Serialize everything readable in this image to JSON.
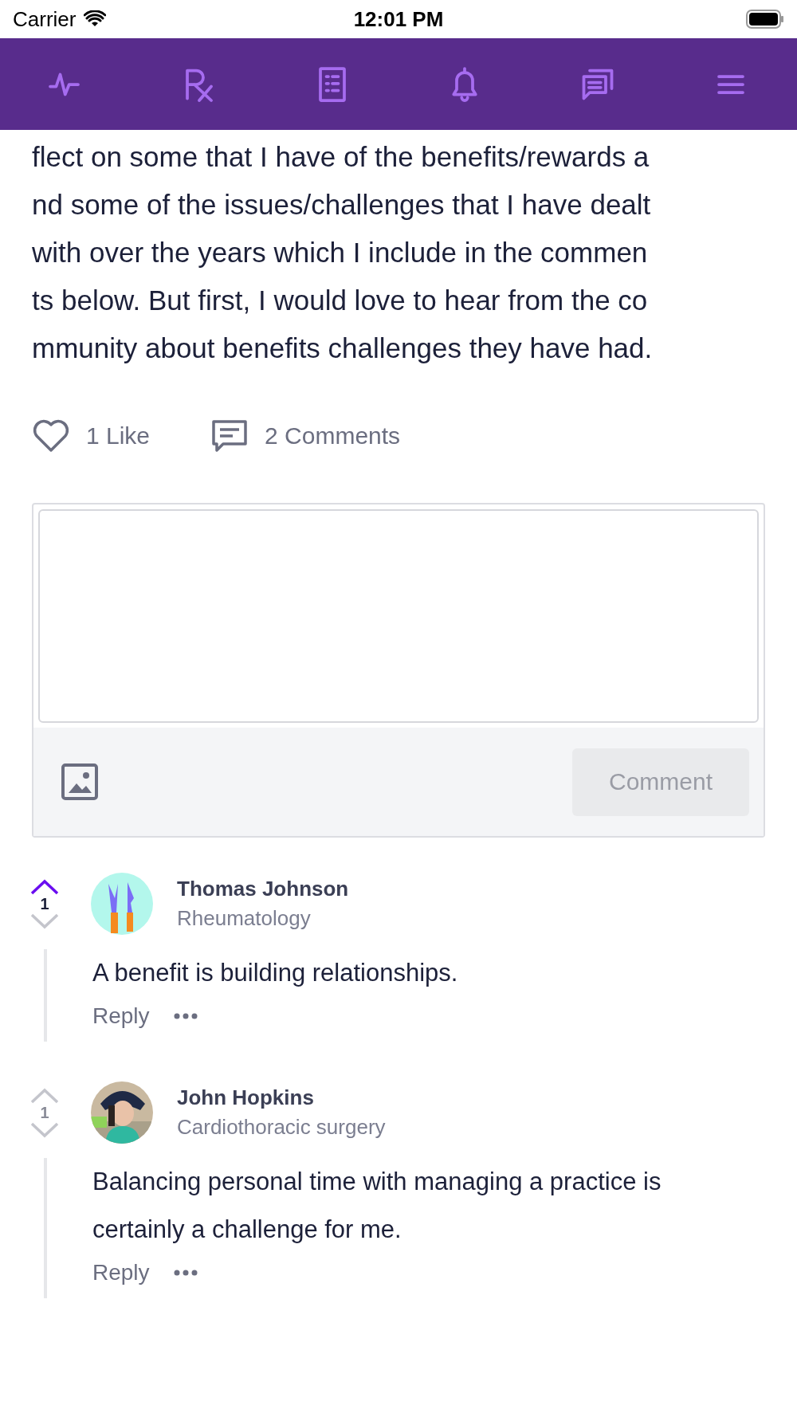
{
  "status_bar": {
    "carrier": "Carrier",
    "time": "12:01 PM"
  },
  "nav_items": [
    {
      "kind": "pulse"
    },
    {
      "kind": "rx"
    },
    {
      "kind": "list"
    },
    {
      "kind": "bell"
    },
    {
      "kind": "chat"
    },
    {
      "kind": "menu"
    }
  ],
  "post": {
    "lines": [
      "flect on some that I have of the benefits/rewards a",
      "nd some of the issues/challenges that I have dealt",
      "with over the years which I include in the commen",
      "ts below. But first, I would love to hear from the co",
      "mmunity about benefits challenges they have had."
    ]
  },
  "actions": {
    "likes": "1 Like",
    "comments": "2 Comments"
  },
  "composer": {
    "button": "Comment",
    "disabled": true
  },
  "comments": [
    {
      "author": "Thomas Johnson",
      "specialty": "Rheumatology",
      "votes": "1",
      "upvoted": true,
      "avatar": {
        "kind": "illustration"
      },
      "body": "A benefit is building relationships.",
      "reply": "Reply"
    },
    {
      "author": "John Hopkins",
      "specialty": "Cardiothoracic surgery",
      "votes": "1",
      "upvoted": false,
      "body": "Balancing personal time with managing a practice is certainly a challenge for me.",
      "reply": "Reply"
    }
  ]
}
